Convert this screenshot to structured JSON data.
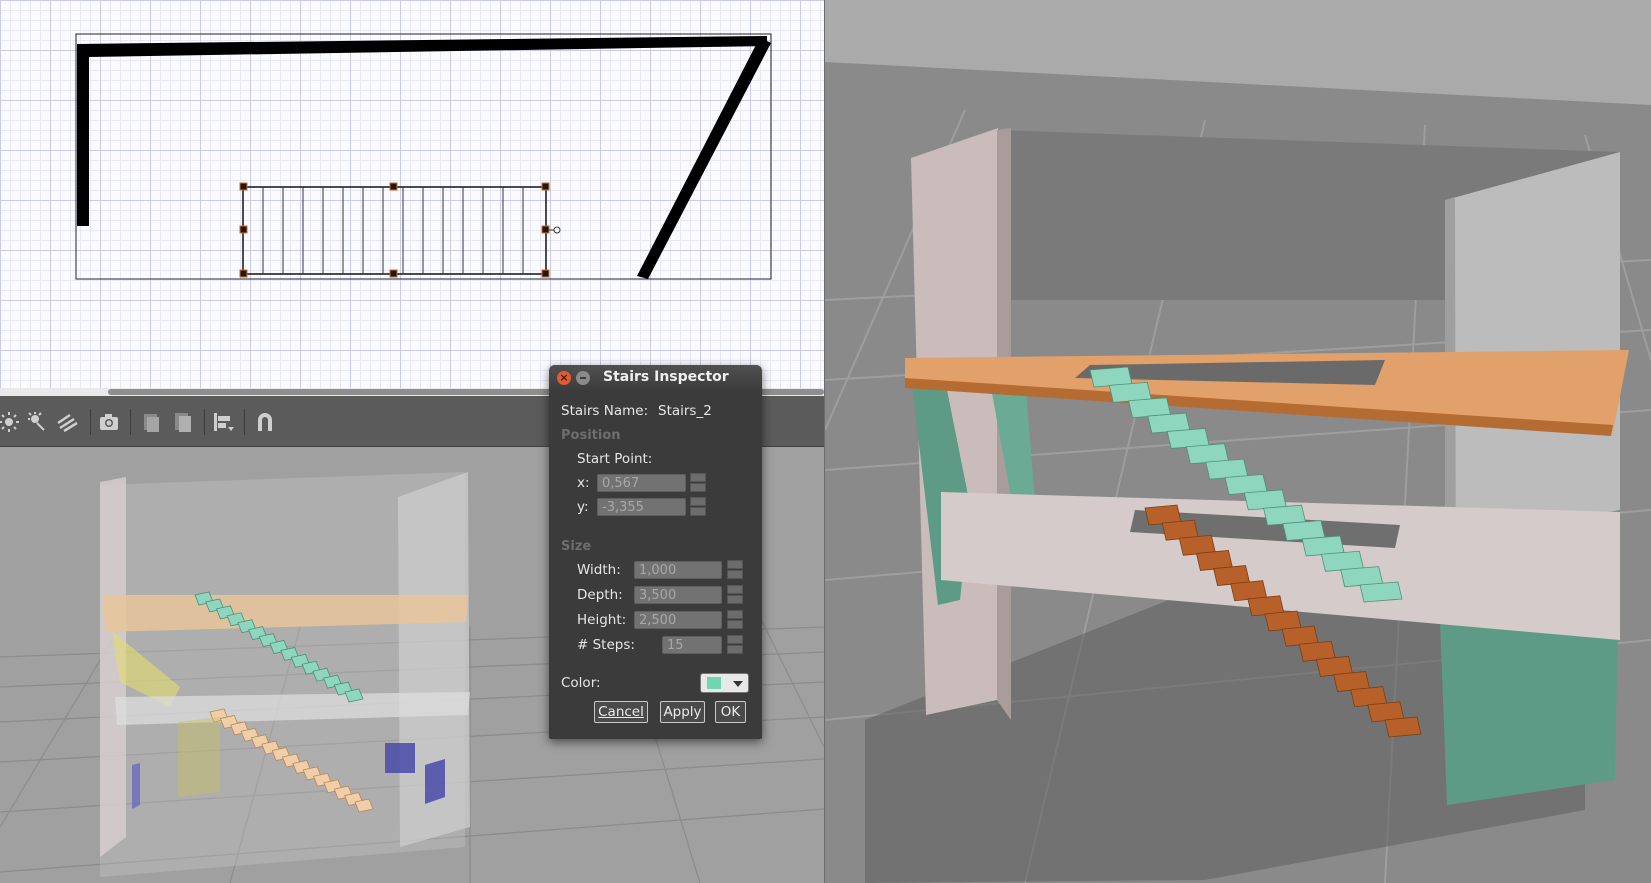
{
  "dialog": {
    "title": "Stairs Inspector",
    "name_label": "Stairs Name:",
    "name_value": "Stairs_2",
    "position_section": "Position",
    "start_point_label": "Start Point:",
    "x_label": "x:",
    "x_value": "0,567",
    "y_label": "y:",
    "y_value": "-3,355",
    "size_section": "Size",
    "width_label": "Width:",
    "width_value": "1,000",
    "depth_label": "Depth:",
    "depth_value": "3,500",
    "height_label": "Height:",
    "height_value": "2,500",
    "steps_label": "# Steps:",
    "steps_value": "15",
    "color_label": "Color:",
    "color_value": "#6fd6b0",
    "cancel_label": "Cancel",
    "apply_label": "Apply",
    "ok_label": "OK"
  },
  "toolbar": {
    "icons": [
      "sun-icon",
      "spotlight-icon",
      "lines-icon",
      "camera-icon",
      "copy-icon",
      "paste-icon",
      "align-icon",
      "magnet-icon"
    ]
  },
  "colors": {
    "stairs_selected": "#8fd6bf",
    "stairs_other": "#b8602a",
    "floor_upper": "#e2a06a",
    "floor_lower": "#cdbfbe",
    "columns": "#5e9b86"
  }
}
